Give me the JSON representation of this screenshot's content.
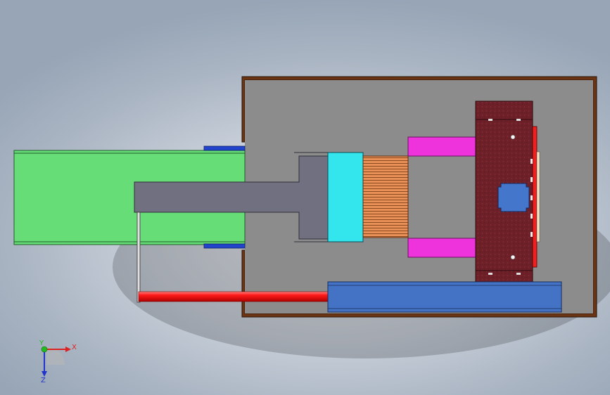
{
  "viewport": {
    "background_top": "#97a5b6",
    "background_center": "#e9ebef"
  },
  "model": {
    "colors": {
      "housing_frame": "#6b3514",
      "housing_floor": "#8c8c8c",
      "green_beam": "#66dd77",
      "gray_arm": "#707080",
      "cyan_block": "#33e6ee",
      "spring_pack": "#e08a4a",
      "magenta_block": "#ee33dd",
      "maroon_plate": "#6e2028",
      "red_strip": "#ee2020",
      "blue_center": "#4477cc",
      "red_rod": "#ee1111",
      "blue_bar": "#4472c4",
      "blue_clip": "#2244cc"
    }
  },
  "triad": {
    "x_label": "X",
    "y_label": "Y",
    "z_label": "Z",
    "x_color": "#dd2222",
    "y_color": "#22bb22",
    "z_color": "#2233cc"
  }
}
